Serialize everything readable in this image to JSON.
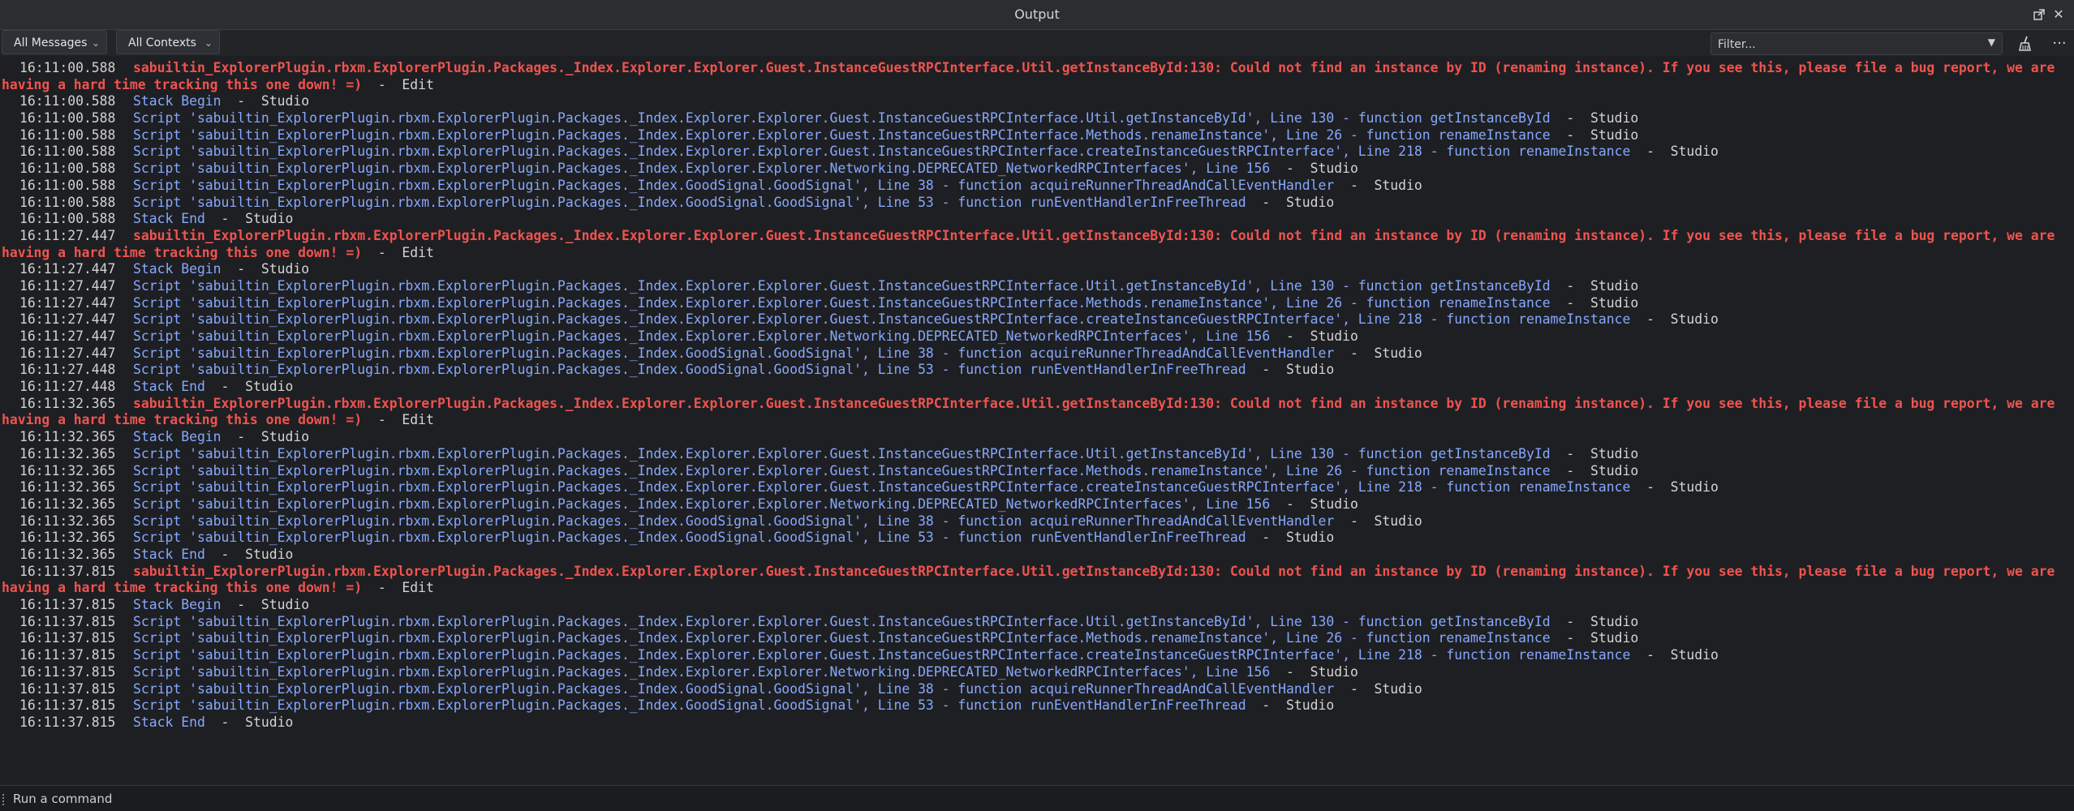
{
  "window": {
    "title": "Output",
    "undock_icon": "undock-icon",
    "close_glyph": "✕"
  },
  "toolbar": {
    "messages_filter": "All Messages",
    "contexts_filter": "All Contexts",
    "filter_placeholder": "Filter...",
    "clear_icon": "broom-icon",
    "more_glyph": "···"
  },
  "log": [
    {
      "type": "error",
      "ts": "16:11:00.588",
      "text": "sabuiltin_ExplorerPlugin.rbxm.ExplorerPlugin.Packages._Index.Explorer.Explorer.Guest.InstanceGuestRPCInterface.Util.getInstanceById:130: Could not find an instance by ID (renaming instance). If you see this, please file a bug report, we are having a hard time tracking this one down! =)",
      "ctx": "  -  Edit"
    },
    {
      "type": "info",
      "ts": "16:11:00.588",
      "text": "Stack Begin",
      "ctx": "  -  Studio"
    },
    {
      "type": "info",
      "ts": "16:11:00.588",
      "text": "Script 'sabuiltin_ExplorerPlugin.rbxm.ExplorerPlugin.Packages._Index.Explorer.Explorer.Guest.InstanceGuestRPCInterface.Util.getInstanceById', Line 130 - function getInstanceById",
      "ctx": "  -  Studio"
    },
    {
      "type": "info",
      "ts": "16:11:00.588",
      "text": "Script 'sabuiltin_ExplorerPlugin.rbxm.ExplorerPlugin.Packages._Index.Explorer.Explorer.Guest.InstanceGuestRPCInterface.Methods.renameInstance', Line 26 - function renameInstance",
      "ctx": "  -  Studio"
    },
    {
      "type": "info",
      "ts": "16:11:00.588",
      "text": "Script 'sabuiltin_ExplorerPlugin.rbxm.ExplorerPlugin.Packages._Index.Explorer.Explorer.Guest.InstanceGuestRPCInterface.createInstanceGuestRPCInterface', Line 218 - function renameInstance",
      "ctx": "  -  Studio"
    },
    {
      "type": "info",
      "ts": "16:11:00.588",
      "text": "Script 'sabuiltin_ExplorerPlugin.rbxm.ExplorerPlugin.Packages._Index.Explorer.Explorer.Networking.DEPRECATED_NetworkedRPCInterfaces', Line 156",
      "ctx": "  -  Studio"
    },
    {
      "type": "info",
      "ts": "16:11:00.588",
      "text": "Script 'sabuiltin_ExplorerPlugin.rbxm.ExplorerPlugin.Packages._Index.GoodSignal.GoodSignal', Line 38 - function acquireRunnerThreadAndCallEventHandler",
      "ctx": "  -  Studio"
    },
    {
      "type": "info",
      "ts": "16:11:00.588",
      "text": "Script 'sabuiltin_ExplorerPlugin.rbxm.ExplorerPlugin.Packages._Index.GoodSignal.GoodSignal', Line 53 - function runEventHandlerInFreeThread",
      "ctx": "  -  Studio"
    },
    {
      "type": "info",
      "ts": "16:11:00.588",
      "text": "Stack End",
      "ctx": "  -  Studio"
    },
    {
      "type": "error",
      "ts": "16:11:27.447",
      "text": "sabuiltin_ExplorerPlugin.rbxm.ExplorerPlugin.Packages._Index.Explorer.Explorer.Guest.InstanceGuestRPCInterface.Util.getInstanceById:130: Could not find an instance by ID (renaming instance). If you see this, please file a bug report, we are having a hard time tracking this one down! =)",
      "ctx": "  -  Edit"
    },
    {
      "type": "info",
      "ts": "16:11:27.447",
      "text": "Stack Begin",
      "ctx": "  -  Studio"
    },
    {
      "type": "info",
      "ts": "16:11:27.447",
      "text": "Script 'sabuiltin_ExplorerPlugin.rbxm.ExplorerPlugin.Packages._Index.Explorer.Explorer.Guest.InstanceGuestRPCInterface.Util.getInstanceById', Line 130 - function getInstanceById",
      "ctx": "  -  Studio"
    },
    {
      "type": "info",
      "ts": "16:11:27.447",
      "text": "Script 'sabuiltin_ExplorerPlugin.rbxm.ExplorerPlugin.Packages._Index.Explorer.Explorer.Guest.InstanceGuestRPCInterface.Methods.renameInstance', Line 26 - function renameInstance",
      "ctx": "  -  Studio"
    },
    {
      "type": "info",
      "ts": "16:11:27.447",
      "text": "Script 'sabuiltin_ExplorerPlugin.rbxm.ExplorerPlugin.Packages._Index.Explorer.Explorer.Guest.InstanceGuestRPCInterface.createInstanceGuestRPCInterface', Line 218 - function renameInstance",
      "ctx": "  -  Studio"
    },
    {
      "type": "info",
      "ts": "16:11:27.447",
      "text": "Script 'sabuiltin_ExplorerPlugin.rbxm.ExplorerPlugin.Packages._Index.Explorer.Explorer.Networking.DEPRECATED_NetworkedRPCInterfaces', Line 156",
      "ctx": "  -  Studio"
    },
    {
      "type": "info",
      "ts": "16:11:27.447",
      "text": "Script 'sabuiltin_ExplorerPlugin.rbxm.ExplorerPlugin.Packages._Index.GoodSignal.GoodSignal', Line 38 - function acquireRunnerThreadAndCallEventHandler",
      "ctx": "  -  Studio"
    },
    {
      "type": "info",
      "ts": "16:11:27.448",
      "text": "Script 'sabuiltin_ExplorerPlugin.rbxm.ExplorerPlugin.Packages._Index.GoodSignal.GoodSignal', Line 53 - function runEventHandlerInFreeThread",
      "ctx": "  -  Studio"
    },
    {
      "type": "info",
      "ts": "16:11:27.448",
      "text": "Stack End",
      "ctx": "  -  Studio"
    },
    {
      "type": "error",
      "ts": "16:11:32.365",
      "text": "sabuiltin_ExplorerPlugin.rbxm.ExplorerPlugin.Packages._Index.Explorer.Explorer.Guest.InstanceGuestRPCInterface.Util.getInstanceById:130: Could not find an instance by ID (renaming instance). If you see this, please file a bug report, we are having a hard time tracking this one down! =)",
      "ctx": "  -  Edit"
    },
    {
      "type": "info",
      "ts": "16:11:32.365",
      "text": "Stack Begin",
      "ctx": "  -  Studio"
    },
    {
      "type": "info",
      "ts": "16:11:32.365",
      "text": "Script 'sabuiltin_ExplorerPlugin.rbxm.ExplorerPlugin.Packages._Index.Explorer.Explorer.Guest.InstanceGuestRPCInterface.Util.getInstanceById', Line 130 - function getInstanceById",
      "ctx": "  -  Studio"
    },
    {
      "type": "info",
      "ts": "16:11:32.365",
      "text": "Script 'sabuiltin_ExplorerPlugin.rbxm.ExplorerPlugin.Packages._Index.Explorer.Explorer.Guest.InstanceGuestRPCInterface.Methods.renameInstance', Line 26 - function renameInstance",
      "ctx": "  -  Studio"
    },
    {
      "type": "info",
      "ts": "16:11:32.365",
      "text": "Script 'sabuiltin_ExplorerPlugin.rbxm.ExplorerPlugin.Packages._Index.Explorer.Explorer.Guest.InstanceGuestRPCInterface.createInstanceGuestRPCInterface', Line 218 - function renameInstance",
      "ctx": "  -  Studio"
    },
    {
      "type": "info",
      "ts": "16:11:32.365",
      "text": "Script 'sabuiltin_ExplorerPlugin.rbxm.ExplorerPlugin.Packages._Index.Explorer.Explorer.Networking.DEPRECATED_NetworkedRPCInterfaces', Line 156",
      "ctx": "  -  Studio"
    },
    {
      "type": "info",
      "ts": "16:11:32.365",
      "text": "Script 'sabuiltin_ExplorerPlugin.rbxm.ExplorerPlugin.Packages._Index.GoodSignal.GoodSignal', Line 38 - function acquireRunnerThreadAndCallEventHandler",
      "ctx": "  -  Studio"
    },
    {
      "type": "info",
      "ts": "16:11:32.365",
      "text": "Script 'sabuiltin_ExplorerPlugin.rbxm.ExplorerPlugin.Packages._Index.GoodSignal.GoodSignal', Line 53 - function runEventHandlerInFreeThread",
      "ctx": "  -  Studio"
    },
    {
      "type": "info",
      "ts": "16:11:32.365",
      "text": "Stack End",
      "ctx": "  -  Studio"
    },
    {
      "type": "error",
      "ts": "16:11:37.815",
      "text": "sabuiltin_ExplorerPlugin.rbxm.ExplorerPlugin.Packages._Index.Explorer.Explorer.Guest.InstanceGuestRPCInterface.Util.getInstanceById:130: Could not find an instance by ID (renaming instance). If you see this, please file a bug report, we are having a hard time tracking this one down! =)",
      "ctx": "  -  Edit"
    },
    {
      "type": "info",
      "ts": "16:11:37.815",
      "text": "Stack Begin",
      "ctx": "  -  Studio"
    },
    {
      "type": "info",
      "ts": "16:11:37.815",
      "text": "Script 'sabuiltin_ExplorerPlugin.rbxm.ExplorerPlugin.Packages._Index.Explorer.Explorer.Guest.InstanceGuestRPCInterface.Util.getInstanceById', Line 130 - function getInstanceById",
      "ctx": "  -  Studio"
    },
    {
      "type": "info",
      "ts": "16:11:37.815",
      "text": "Script 'sabuiltin_ExplorerPlugin.rbxm.ExplorerPlugin.Packages._Index.Explorer.Explorer.Guest.InstanceGuestRPCInterface.Methods.renameInstance', Line 26 - function renameInstance",
      "ctx": "  -  Studio"
    },
    {
      "type": "info",
      "ts": "16:11:37.815",
      "text": "Script 'sabuiltin_ExplorerPlugin.rbxm.ExplorerPlugin.Packages._Index.Explorer.Explorer.Guest.InstanceGuestRPCInterface.createInstanceGuestRPCInterface', Line 218 - function renameInstance",
      "ctx": "  -  Studio"
    },
    {
      "type": "info",
      "ts": "16:11:37.815",
      "text": "Script 'sabuiltin_ExplorerPlugin.rbxm.ExplorerPlugin.Packages._Index.Explorer.Explorer.Networking.DEPRECATED_NetworkedRPCInterfaces', Line 156",
      "ctx": "  -  Studio"
    },
    {
      "type": "info",
      "ts": "16:11:37.815",
      "text": "Script 'sabuiltin_ExplorerPlugin.rbxm.ExplorerPlugin.Packages._Index.GoodSignal.GoodSignal', Line 38 - function acquireRunnerThreadAndCallEventHandler",
      "ctx": "  -  Studio"
    },
    {
      "type": "info",
      "ts": "16:11:37.815",
      "text": "Script 'sabuiltin_ExplorerPlugin.rbxm.ExplorerPlugin.Packages._Index.GoodSignal.GoodSignal', Line 53 - function runEventHandlerInFreeThread",
      "ctx": "  -  Studio"
    },
    {
      "type": "info",
      "ts": "16:11:37.815",
      "text": "Stack End",
      "ctx": "  -  Studio"
    }
  ],
  "command_bar": {
    "placeholder": "Run a command"
  },
  "colors": {
    "background": "#1e1f22",
    "error": "#ef5350",
    "info": "#86a8ff",
    "timestamp": "#d2d2d2"
  }
}
